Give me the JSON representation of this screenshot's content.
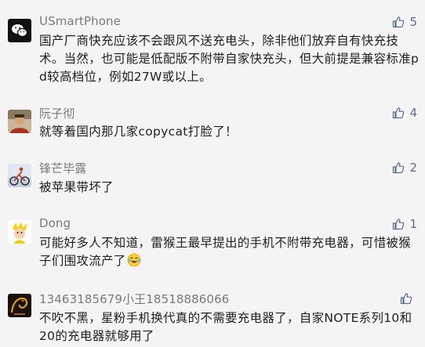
{
  "comments": [
    {
      "nickname": "USmartPhone",
      "text": "国产厂商快充应该不会跟风不送充电头，除非他们放弃自有快充技术。当然，也可能是低配版不附带自家快充头，但大前提是兼容标准pd较高档位，例如27W或以上。",
      "likes": "5",
      "avatar_icon": "wechat-logo-icon"
    },
    {
      "nickname": "阮子彻",
      "text": "就等着国内那几家copycat打脸了！",
      "likes": "4",
      "avatar_icon": "person-photo-icon"
    },
    {
      "nickname": "锋芒毕露",
      "text": "被苹果带坏了",
      "likes": "2",
      "avatar_icon": "cyclist-photo-icon"
    },
    {
      "nickname": "Dong",
      "text": "可能好多人不知道，雷猴王最早提出的手机不附带充电器，可惜被猴子们围攻流产了",
      "likes": "1",
      "avatar_icon": "cartoon-avatar-icon",
      "emoji": "laughing-tears-emoji"
    },
    {
      "nickname": "13463185679小王18518886066",
      "text": "不吹不黑，星粉手机换代真的不需要充电器了，自家NOTE系列10和20的充电器就够用了",
      "likes": "",
      "avatar_icon": "dragon-avatar-icon"
    }
  ],
  "colors": {
    "background": "#f4f4f4",
    "nickname": "#7a7a7a",
    "text": "#1f1f1f",
    "like": "#576b95"
  }
}
